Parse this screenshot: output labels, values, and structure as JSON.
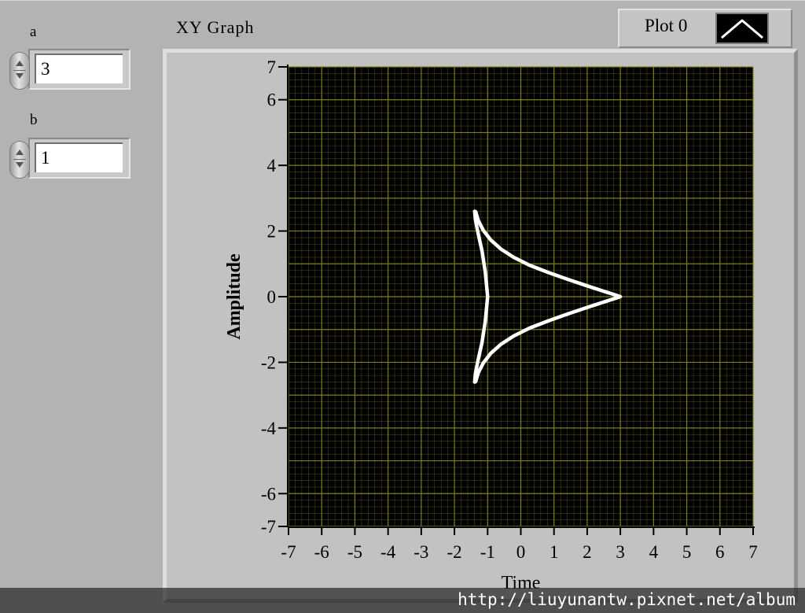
{
  "controls": {
    "a": {
      "label": "a",
      "value": "3"
    },
    "b": {
      "label": "b",
      "value": "1"
    }
  },
  "graph": {
    "label": "XY Graph",
    "legend": {
      "plot_name": "Plot 0"
    }
  },
  "colors": {
    "plot_background": "#000000",
    "grid": "#7f7f1a",
    "trace": "#ffffff",
    "panel": "#b3b3b3"
  },
  "chart_data": {
    "type": "line",
    "title": "",
    "xlabel": "Time",
    "ylabel": "Amplitude",
    "xlim": [
      -7,
      7
    ],
    "ylim": [
      -7,
      7
    ],
    "x_ticks": [
      "-7",
      "-6",
      "-5",
      "-4",
      "-3",
      "-2",
      "-1",
      "0",
      "1",
      "2",
      "3",
      "4",
      "5",
      "6",
      "7"
    ],
    "y_ticks": [
      "7",
      "6",
      "4",
      "2",
      "0",
      "-2",
      "-4",
      "-6",
      "-7"
    ],
    "y_tick_values": [
      7,
      6,
      4,
      2,
      0,
      -2,
      -4,
      -6,
      -7
    ],
    "grid": true,
    "series": [
      {
        "name": "Plot 0",
        "x": [
          3.0,
          2.88,
          2.54,
          2.03,
          1.43,
          0.82,
          0.26,
          -0.22,
          -0.6,
          -0.91,
          -1.13,
          -1.28,
          -1.36,
          -1.39,
          -1.37,
          -1.29,
          -1.17,
          -1.07,
          -1.0,
          -1.07,
          -1.17,
          -1.29,
          -1.37,
          -1.39,
          -1.36,
          -1.28,
          -1.13,
          -0.91,
          -0.6,
          -0.22,
          0.26,
          0.82,
          1.43,
          2.03,
          2.54,
          2.88,
          3.0
        ],
        "y": [
          0.0,
          0.04,
          0.15,
          0.32,
          0.52,
          0.74,
          0.96,
          1.2,
          1.45,
          1.73,
          2.02,
          2.31,
          2.59,
          2.6,
          2.35,
          1.95,
          1.4,
          0.75,
          0.0,
          -0.75,
          -1.4,
          -1.95,
          -2.35,
          -2.6,
          -2.59,
          -2.31,
          -2.02,
          -1.73,
          -1.45,
          -1.2,
          -0.96,
          -0.74,
          -0.52,
          -0.32,
          -0.15,
          -0.04,
          0.0
        ]
      }
    ]
  },
  "watermark": "http://liuyunantw.pixnet.net/album"
}
